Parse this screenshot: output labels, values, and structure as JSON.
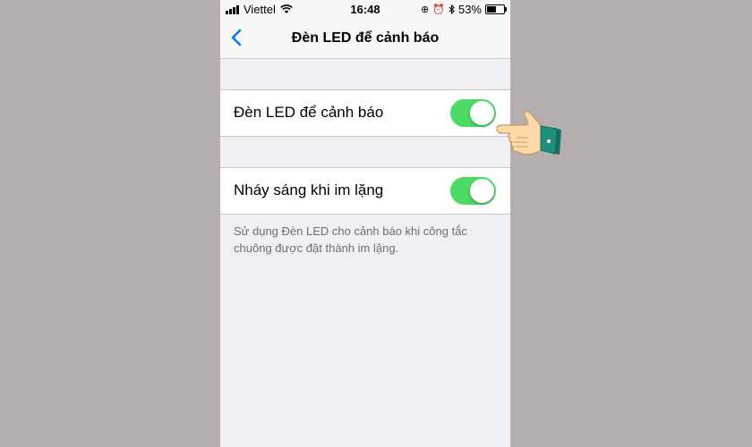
{
  "status_bar": {
    "carrier": "Viettel",
    "time": "16:48",
    "battery_percent": "53%",
    "battery_level": 0.53,
    "icons": [
      "signal-icon",
      "wifi-icon",
      "orientation-lock-icon",
      "alarm-icon",
      "bluetooth-icon",
      "battery-icon"
    ]
  },
  "nav": {
    "title": "Đèn LED để cảnh báo",
    "back_icon": "chevron-left-icon"
  },
  "settings": {
    "led_alert": {
      "label": "Đèn LED để cảnh báo",
      "enabled": true
    },
    "flash_on_silent": {
      "label": "Nháy sáng khi im lặng",
      "enabled": true
    },
    "footer": "Sử dụng Đèn LED cho cảnh báo khi công tắc chuông được đặt thành im lặng."
  },
  "colors": {
    "accent": "#007aff",
    "toggle_on": "#4cd964",
    "page_background": "#b5aeae",
    "settings_background": "#efeff4"
  }
}
